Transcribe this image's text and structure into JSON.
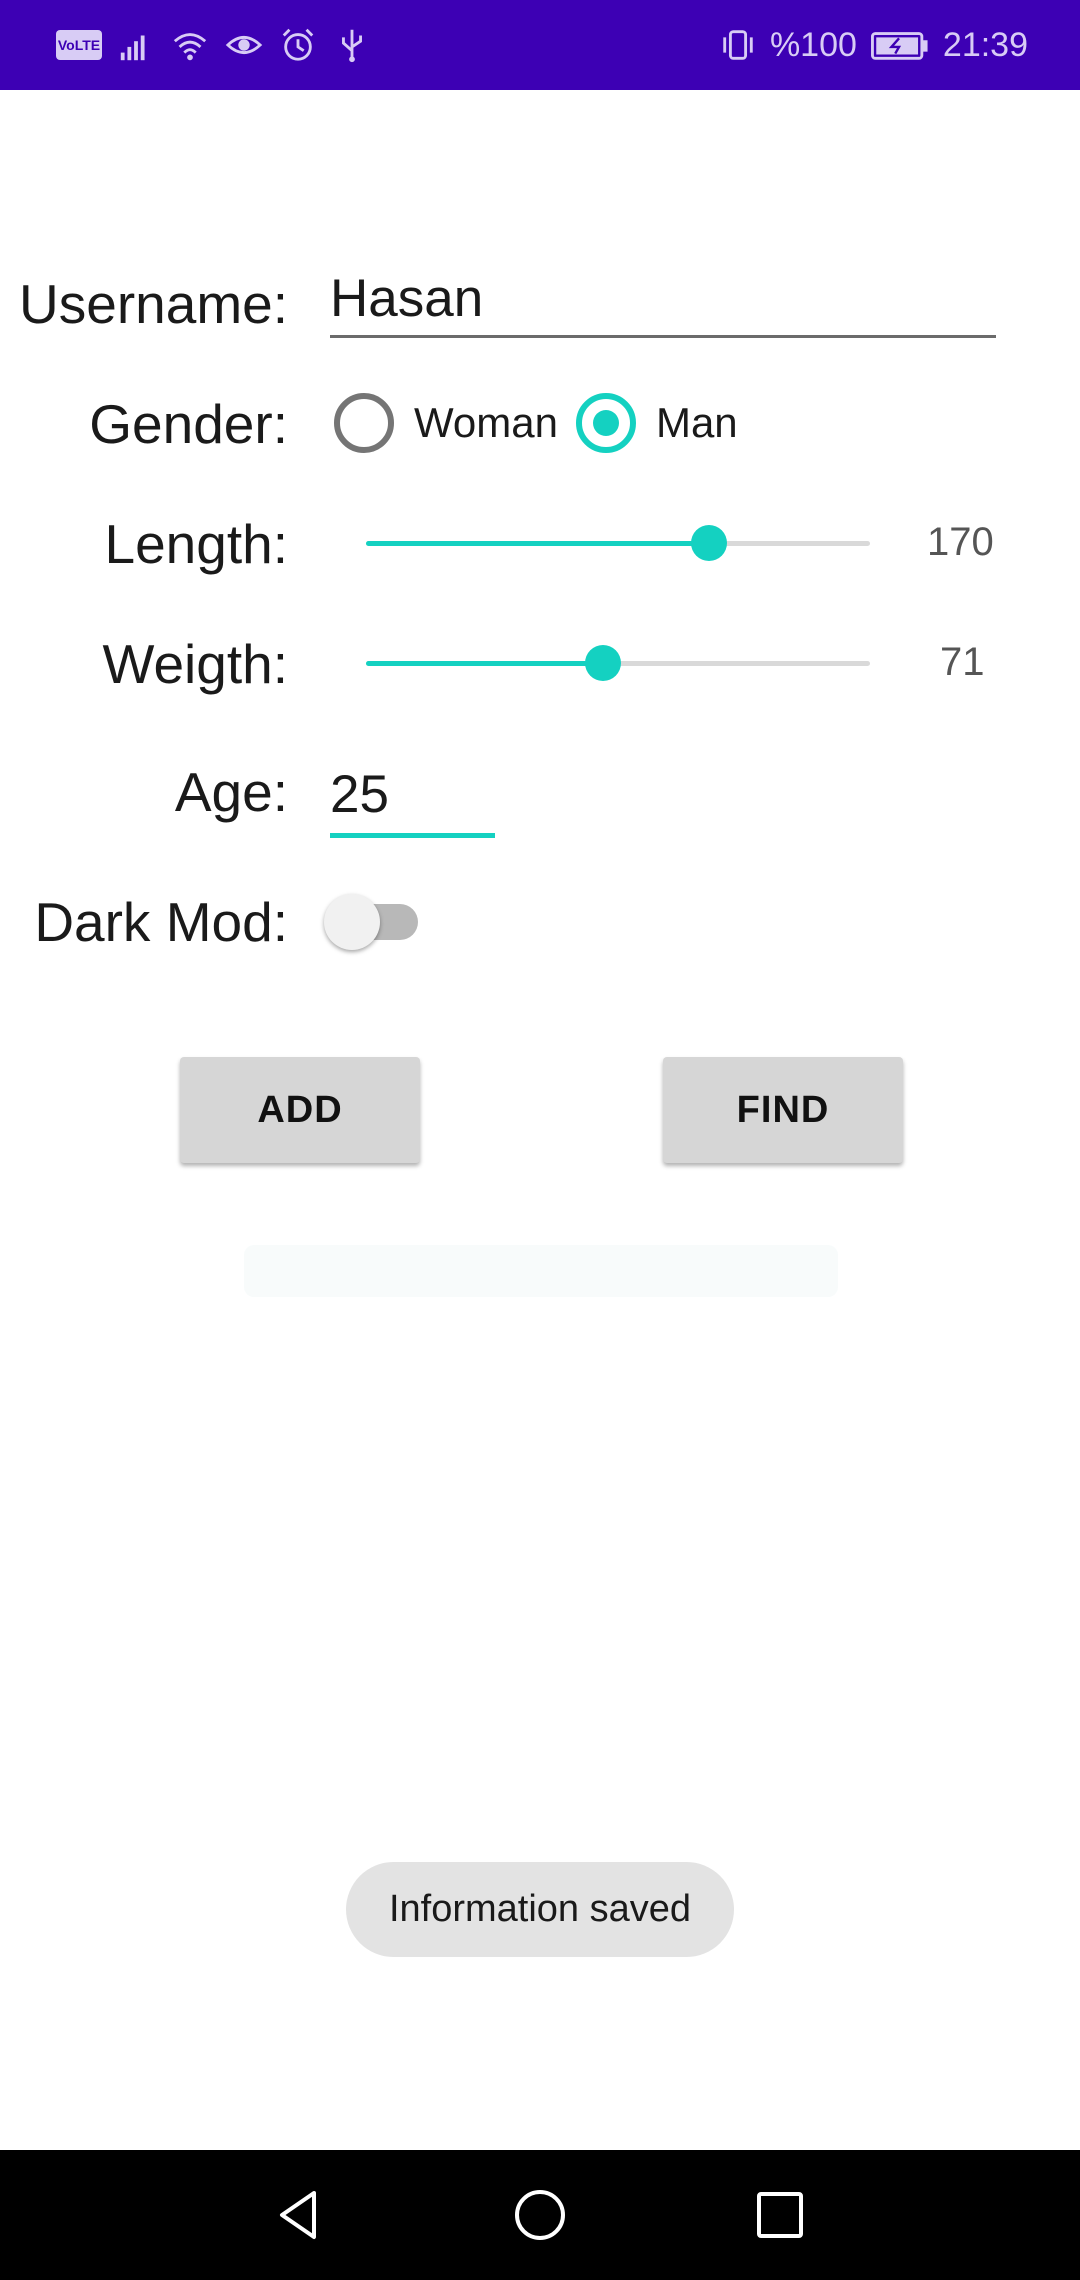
{
  "status_bar": {
    "volte": "VoLTE",
    "battery_percent": "%100",
    "time": "21:39",
    "icons": [
      "signal-icon",
      "wifi-icon",
      "eye-icon",
      "alarm-icon",
      "usb-icon",
      "vibrate-icon",
      "battery-charging-icon"
    ]
  },
  "form": {
    "username_label": "Username:",
    "username_value": "Hasan",
    "gender_label": "Gender:",
    "gender_options": [
      "Woman",
      "Man"
    ],
    "gender_selected": "Man",
    "length_label": "Length:",
    "length_value": "170",
    "length_fraction": 0.68,
    "weight_label": "Weigth:",
    "weight_value": "71",
    "weight_fraction": 0.47,
    "age_label": "Age:",
    "age_value": "25",
    "dark_mode_label": "Dark Mod:",
    "dark_mode_on": false
  },
  "buttons": {
    "add": "ADD",
    "find": "FIND"
  },
  "toast": "Information saved",
  "colors": {
    "status_bar": "#3d00b4",
    "accent": "#14d1c1"
  },
  "nav": [
    "back-icon",
    "home-icon",
    "recents-icon"
  ]
}
